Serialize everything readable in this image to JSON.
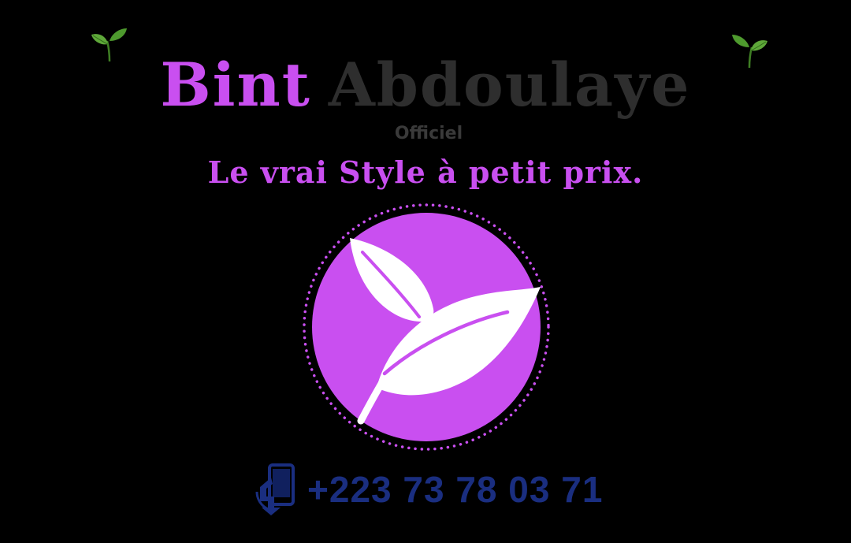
{
  "brand": {
    "first_word": "Bint",
    "second_word": "Abdoulaye",
    "subtitle": "Officiel"
  },
  "tagline": "Le vrai Style à petit prix.",
  "logo": {
    "icon": "leaf-icon",
    "circle_color": "#c94ff0",
    "leaf_color": "#ffffff"
  },
  "contact": {
    "phone_icon": "phone-icon",
    "phone_number": "+223 73 78 03 71"
  },
  "colors": {
    "background": "#000000",
    "accent_purple": "#c94ff0",
    "dark_gray": "#2e2e2e",
    "navy": "#1a2e80",
    "sprout_green": "#5fa83a"
  }
}
